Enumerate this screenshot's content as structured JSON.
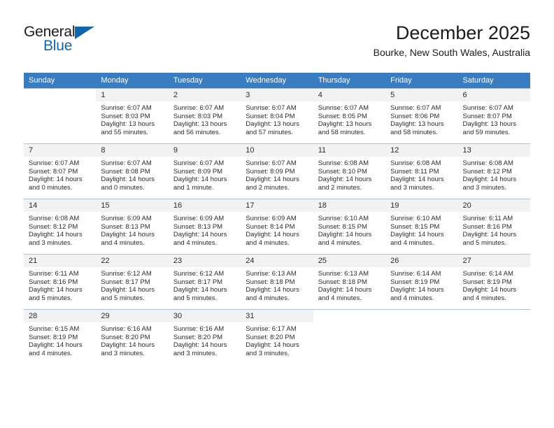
{
  "brand": {
    "name_part1": "General",
    "name_part2": "Blue"
  },
  "header": {
    "title": "December 2025",
    "subtitle": "Bourke, New South Wales, Australia"
  },
  "calendar": {
    "weekday_headers": [
      "Sunday",
      "Monday",
      "Tuesday",
      "Wednesday",
      "Thursday",
      "Friday",
      "Saturday"
    ],
    "header_bg": "#3a7cc0",
    "daynum_bg": "#f2f2f2",
    "weeks": [
      [
        {
          "day": "",
          "sunrise": "",
          "sunset": "",
          "daylight1": "",
          "daylight2": ""
        },
        {
          "day": "1",
          "sunrise": "Sunrise: 6:07 AM",
          "sunset": "Sunset: 8:03 PM",
          "daylight1": "Daylight: 13 hours",
          "daylight2": "and 55 minutes."
        },
        {
          "day": "2",
          "sunrise": "Sunrise: 6:07 AM",
          "sunset": "Sunset: 8:03 PM",
          "daylight1": "Daylight: 13 hours",
          "daylight2": "and 56 minutes."
        },
        {
          "day": "3",
          "sunrise": "Sunrise: 6:07 AM",
          "sunset": "Sunset: 8:04 PM",
          "daylight1": "Daylight: 13 hours",
          "daylight2": "and 57 minutes."
        },
        {
          "day": "4",
          "sunrise": "Sunrise: 6:07 AM",
          "sunset": "Sunset: 8:05 PM",
          "daylight1": "Daylight: 13 hours",
          "daylight2": "and 58 minutes."
        },
        {
          "day": "5",
          "sunrise": "Sunrise: 6:07 AM",
          "sunset": "Sunset: 8:06 PM",
          "daylight1": "Daylight: 13 hours",
          "daylight2": "and 58 minutes."
        },
        {
          "day": "6",
          "sunrise": "Sunrise: 6:07 AM",
          "sunset": "Sunset: 8:07 PM",
          "daylight1": "Daylight: 13 hours",
          "daylight2": "and 59 minutes."
        }
      ],
      [
        {
          "day": "7",
          "sunrise": "Sunrise: 6:07 AM",
          "sunset": "Sunset: 8:07 PM",
          "daylight1": "Daylight: 14 hours",
          "daylight2": "and 0 minutes."
        },
        {
          "day": "8",
          "sunrise": "Sunrise: 6:07 AM",
          "sunset": "Sunset: 8:08 PM",
          "daylight1": "Daylight: 14 hours",
          "daylight2": "and 0 minutes."
        },
        {
          "day": "9",
          "sunrise": "Sunrise: 6:07 AM",
          "sunset": "Sunset: 8:09 PM",
          "daylight1": "Daylight: 14 hours",
          "daylight2": "and 1 minute."
        },
        {
          "day": "10",
          "sunrise": "Sunrise: 6:07 AM",
          "sunset": "Sunset: 8:09 PM",
          "daylight1": "Daylight: 14 hours",
          "daylight2": "and 2 minutes."
        },
        {
          "day": "11",
          "sunrise": "Sunrise: 6:08 AM",
          "sunset": "Sunset: 8:10 PM",
          "daylight1": "Daylight: 14 hours",
          "daylight2": "and 2 minutes."
        },
        {
          "day": "12",
          "sunrise": "Sunrise: 6:08 AM",
          "sunset": "Sunset: 8:11 PM",
          "daylight1": "Daylight: 14 hours",
          "daylight2": "and 3 minutes."
        },
        {
          "day": "13",
          "sunrise": "Sunrise: 6:08 AM",
          "sunset": "Sunset: 8:12 PM",
          "daylight1": "Daylight: 14 hours",
          "daylight2": "and 3 minutes."
        }
      ],
      [
        {
          "day": "14",
          "sunrise": "Sunrise: 6:08 AM",
          "sunset": "Sunset: 8:12 PM",
          "daylight1": "Daylight: 14 hours",
          "daylight2": "and 3 minutes."
        },
        {
          "day": "15",
          "sunrise": "Sunrise: 6:09 AM",
          "sunset": "Sunset: 8:13 PM",
          "daylight1": "Daylight: 14 hours",
          "daylight2": "and 4 minutes."
        },
        {
          "day": "16",
          "sunrise": "Sunrise: 6:09 AM",
          "sunset": "Sunset: 8:13 PM",
          "daylight1": "Daylight: 14 hours",
          "daylight2": "and 4 minutes."
        },
        {
          "day": "17",
          "sunrise": "Sunrise: 6:09 AM",
          "sunset": "Sunset: 8:14 PM",
          "daylight1": "Daylight: 14 hours",
          "daylight2": "and 4 minutes."
        },
        {
          "day": "18",
          "sunrise": "Sunrise: 6:10 AM",
          "sunset": "Sunset: 8:15 PM",
          "daylight1": "Daylight: 14 hours",
          "daylight2": "and 4 minutes."
        },
        {
          "day": "19",
          "sunrise": "Sunrise: 6:10 AM",
          "sunset": "Sunset: 8:15 PM",
          "daylight1": "Daylight: 14 hours",
          "daylight2": "and 4 minutes."
        },
        {
          "day": "20",
          "sunrise": "Sunrise: 6:11 AM",
          "sunset": "Sunset: 8:16 PM",
          "daylight1": "Daylight: 14 hours",
          "daylight2": "and 5 minutes."
        }
      ],
      [
        {
          "day": "21",
          "sunrise": "Sunrise: 6:11 AM",
          "sunset": "Sunset: 8:16 PM",
          "daylight1": "Daylight: 14 hours",
          "daylight2": "and 5 minutes."
        },
        {
          "day": "22",
          "sunrise": "Sunrise: 6:12 AM",
          "sunset": "Sunset: 8:17 PM",
          "daylight1": "Daylight: 14 hours",
          "daylight2": "and 5 minutes."
        },
        {
          "day": "23",
          "sunrise": "Sunrise: 6:12 AM",
          "sunset": "Sunset: 8:17 PM",
          "daylight1": "Daylight: 14 hours",
          "daylight2": "and 5 minutes."
        },
        {
          "day": "24",
          "sunrise": "Sunrise: 6:13 AM",
          "sunset": "Sunset: 8:18 PM",
          "daylight1": "Daylight: 14 hours",
          "daylight2": "and 4 minutes."
        },
        {
          "day": "25",
          "sunrise": "Sunrise: 6:13 AM",
          "sunset": "Sunset: 8:18 PM",
          "daylight1": "Daylight: 14 hours",
          "daylight2": "and 4 minutes."
        },
        {
          "day": "26",
          "sunrise": "Sunrise: 6:14 AM",
          "sunset": "Sunset: 8:19 PM",
          "daylight1": "Daylight: 14 hours",
          "daylight2": "and 4 minutes."
        },
        {
          "day": "27",
          "sunrise": "Sunrise: 6:14 AM",
          "sunset": "Sunset: 8:19 PM",
          "daylight1": "Daylight: 14 hours",
          "daylight2": "and 4 minutes."
        }
      ],
      [
        {
          "day": "28",
          "sunrise": "Sunrise: 6:15 AM",
          "sunset": "Sunset: 8:19 PM",
          "daylight1": "Daylight: 14 hours",
          "daylight2": "and 4 minutes."
        },
        {
          "day": "29",
          "sunrise": "Sunrise: 6:16 AM",
          "sunset": "Sunset: 8:20 PM",
          "daylight1": "Daylight: 14 hours",
          "daylight2": "and 3 minutes."
        },
        {
          "day": "30",
          "sunrise": "Sunrise: 6:16 AM",
          "sunset": "Sunset: 8:20 PM",
          "daylight1": "Daylight: 14 hours",
          "daylight2": "and 3 minutes."
        },
        {
          "day": "31",
          "sunrise": "Sunrise: 6:17 AM",
          "sunset": "Sunset: 8:20 PM",
          "daylight1": "Daylight: 14 hours",
          "daylight2": "and 3 minutes."
        },
        {
          "day": "",
          "sunrise": "",
          "sunset": "",
          "daylight1": "",
          "daylight2": ""
        },
        {
          "day": "",
          "sunrise": "",
          "sunset": "",
          "daylight1": "",
          "daylight2": ""
        },
        {
          "day": "",
          "sunrise": "",
          "sunset": "",
          "daylight1": "",
          "daylight2": ""
        }
      ]
    ]
  }
}
